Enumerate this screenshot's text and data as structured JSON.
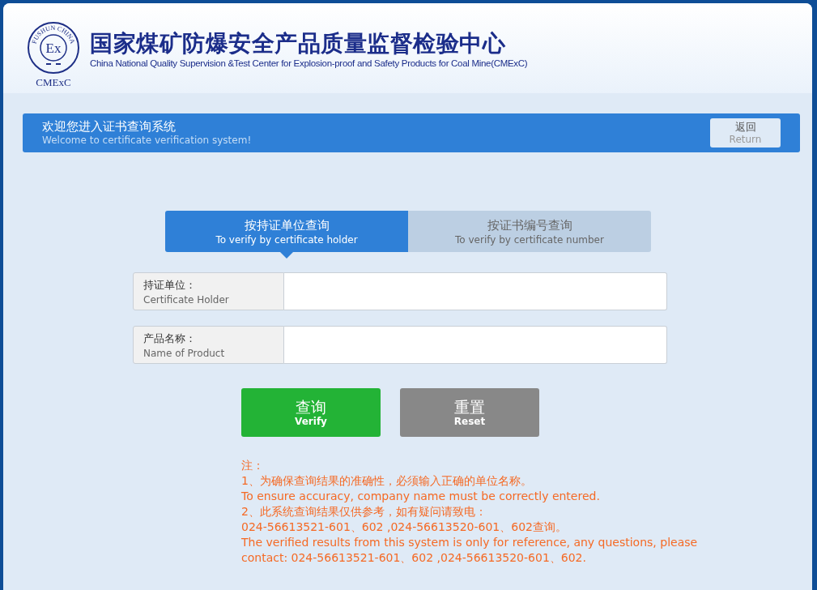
{
  "header": {
    "logo": {
      "ring_text": "FUSHUN CHINA",
      "mark": "Ex",
      "caption": "CMExC"
    },
    "title": "国家煤矿防爆安全产品质量监督检验中心",
    "subtitle": "China National Quality Supervision &Test Center for Explosion-proof and Safety Products for Coal Mine(CMExC)"
  },
  "banner": {
    "title": "欢迎您进入证书查询系统",
    "subtitle": "Welcome to certificate verification system!",
    "button": {
      "label": "返回",
      "sublabel": "Return"
    }
  },
  "tabs": [
    {
      "label": "按持证单位查询",
      "sublabel": "To verify by certificate holder",
      "selected": true
    },
    {
      "label": "按证书编号查询",
      "sublabel": "To verify by certificate number",
      "selected": false
    }
  ],
  "fields": [
    {
      "label": "持证单位：",
      "sublabel": "Certificate Holder"
    },
    {
      "label": "产品名称：",
      "sublabel": "Name of Product"
    }
  ],
  "buttons": [
    {
      "kind": "primary",
      "label": "查询",
      "sublabel": "Verify"
    },
    {
      "kind": "secondary",
      "label": "重置",
      "sublabel": "Reset"
    }
  ],
  "notes": [
    "注：",
    "1、为确保查询结果的准确性，必须输入正确的单位名称。",
    "To ensure accuracy, company name must be correctly entered.",
    "2、此系统查询结果仅供参考，如有疑问请致电：",
    "024-56613521-601、602 ,024-56613520-601、602查询。",
    "The verified results from this system is only for reference, any questions, please",
    "contact: 024-56613521-601、602 ,024-56613520-601、602."
  ]
}
